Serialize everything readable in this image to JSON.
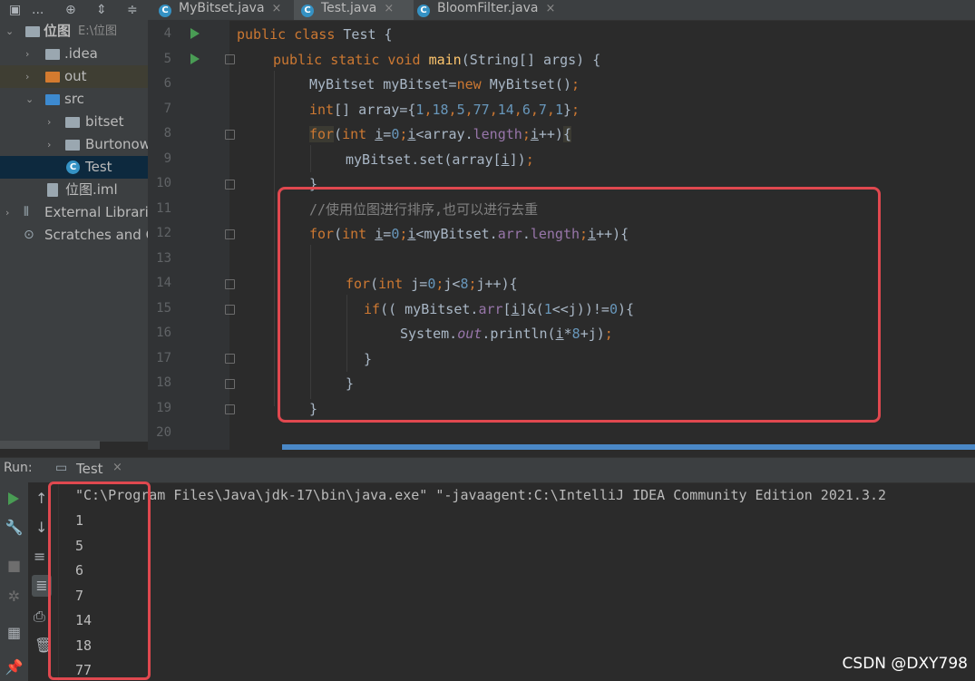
{
  "toolbar": {
    "dots": "...",
    "tabs": [
      {
        "label": "MyBitset.java",
        "close": "×"
      },
      {
        "label": "Test.java",
        "close": "×"
      },
      {
        "label": "BloomFilter.java",
        "close": "×"
      }
    ]
  },
  "tree": {
    "items": [
      {
        "label": "位图",
        "path": "E:\\位图"
      },
      {
        "label": ".idea"
      },
      {
        "label": "out"
      },
      {
        "label": "src"
      },
      {
        "label": "bitset"
      },
      {
        "label": "Burtonow"
      },
      {
        "label": "Test"
      },
      {
        "label": "位图.iml"
      },
      {
        "label": "External Librarie"
      },
      {
        "label": "Scratches and C"
      }
    ]
  },
  "editor": {
    "line_numbers": [
      "4",
      "5",
      "6",
      "7",
      "8",
      "9",
      "10",
      "11",
      "12",
      "13",
      "14",
      "15",
      "16",
      "17",
      "18",
      "19",
      "20"
    ]
  },
  "run": {
    "label": "Run:",
    "tab": "Test",
    "close": "×",
    "command": "\"C:\\Program Files\\Java\\jdk-17\\bin\\java.exe\" \"-javaagent:C:\\IntelliJ IDEA Community Edition 2021.3.2",
    "output": [
      "1",
      "5",
      "6",
      "7",
      "14",
      "18",
      "77"
    ]
  },
  "watermark": "CSDN @DXY798",
  "colors": {
    "keyword": "#cc7832",
    "number": "#6897bb",
    "field": "#9876aa",
    "method": "#ffc66d",
    "comment": "#808080",
    "highlight": "#e0484f"
  }
}
